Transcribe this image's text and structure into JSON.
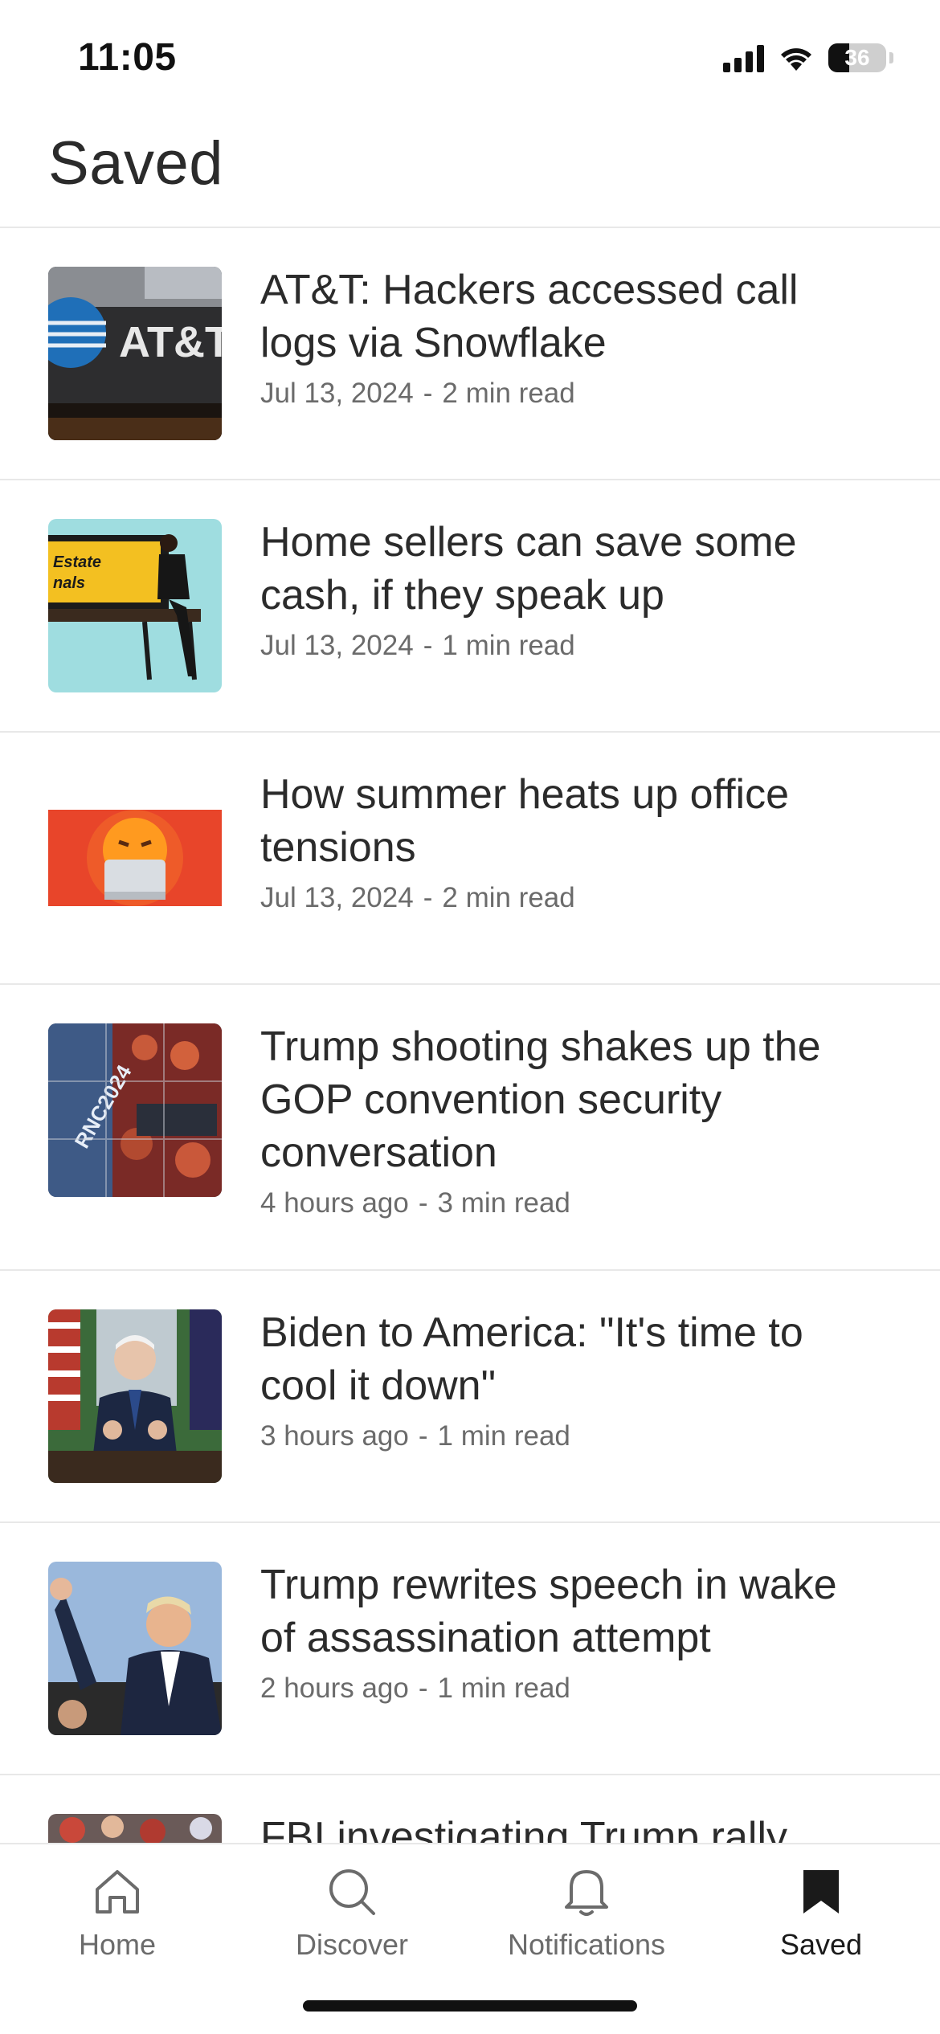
{
  "status_bar": {
    "time": "11:05",
    "battery": "36",
    "battery_level": 0.36,
    "icons": [
      "cellular-signal-icon",
      "wifi-icon",
      "battery-icon"
    ]
  },
  "header": {
    "title": "Saved"
  },
  "articles": [
    {
      "title": "AT&T: Hackers accessed call logs via Snowflake",
      "date": "Jul 13, 2024",
      "separator": "-",
      "read_time": "2 min read",
      "thumbnail": "att-building-photo"
    },
    {
      "title": "Home sellers can save some cash, if they speak up",
      "date": "Jul 13, 2024",
      "separator": "-",
      "read_time": "1 min read",
      "thumbnail": "woman-on-bench-photo"
    },
    {
      "title": "How summer heats up office tensions",
      "date": "Jul 13, 2024",
      "separator": "-",
      "read_time": "2 min read",
      "thumbnail": "angry-emoji-laptop-illustration"
    },
    {
      "title": "Trump shooting shakes up the GOP convention security conversation",
      "date": "4 hours ago",
      "separator": "-",
      "read_time": "3 min read",
      "thumbnail": "rnc-collage-photo"
    },
    {
      "title": "Biden to America: \"It's time to cool it down\"",
      "date": "3 hours ago",
      "separator": "-",
      "read_time": "1 min read",
      "thumbnail": "biden-oval-office-photo"
    },
    {
      "title": "Trump rewrites speech in wake of assassination attempt",
      "date": "2 hours ago",
      "separator": "-",
      "read_time": "1 min read",
      "thumbnail": "trump-fist-raised-photo"
    },
    {
      "title": "FBI investigating Trump rally",
      "date": "",
      "separator": "",
      "read_time": "",
      "thumbnail": "rally-crowd-photo"
    }
  ],
  "tab_bar": {
    "tabs": [
      {
        "label": "Home",
        "icon": "home-icon",
        "active": false
      },
      {
        "label": "Discover",
        "icon": "search-icon",
        "active": false
      },
      {
        "label": "Notifications",
        "icon": "bell-icon",
        "active": false
      },
      {
        "label": "Saved",
        "icon": "bookmark-icon",
        "active": true
      }
    ]
  },
  "colors": {
    "text_primary": "#2b2b2b",
    "text_secondary": "#6b6b6b",
    "divider": "#e8e8e8",
    "background": "#ffffff"
  }
}
